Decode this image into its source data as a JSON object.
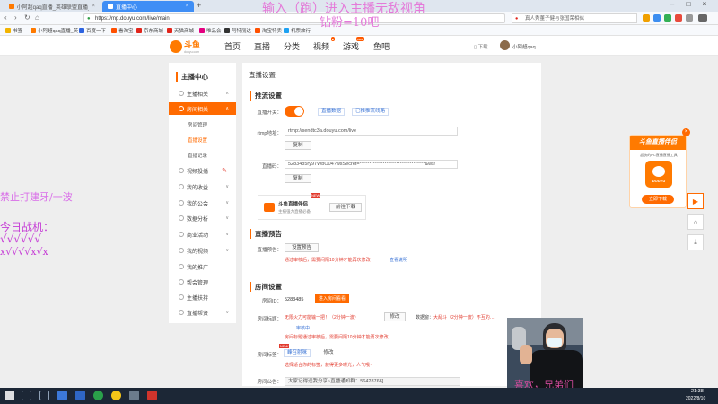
{
  "browser": {
    "tabs": [
      {
        "label": "小阿超qaq直播_英雄联盟直播_斗鱼直…",
        "active": false
      },
      {
        "label": "直播中心",
        "active": true
      }
    ],
    "url": "https://mp.douyu.com/live/main",
    "search_placeholder": "真人秀董子健与张国荣相似",
    "bookmarks": [
      "书签",
      "小阿超qaq直播_英",
      "百度一下",
      "看淘宝",
      "京东商城",
      "天猫商城",
      "唯品会",
      "阿特丽达",
      "淘宝特卖",
      "机票旅行"
    ]
  },
  "overlay": {
    "top_line1": "输入（跑）进入主播无敌视角",
    "top_line2": "钻粉=10吧",
    "left_line1": "禁止打建牙/一波",
    "left_line2": "今日战机：",
    "left_line3": "√√√√√√",
    "left_line4": "x√√√√x√x",
    "cam_caption": "喜欢，兄弟们"
  },
  "site": {
    "logo": "斗鱼",
    "logo_sub": "douyu.com",
    "nav": [
      {
        "label": "首页",
        "badge": ""
      },
      {
        "label": "直播",
        "badge": ""
      },
      {
        "label": "分类",
        "badge": ""
      },
      {
        "label": "视频",
        "badge": "●"
      },
      {
        "label": "游戏",
        "badge": "new"
      },
      {
        "label": "鱼吧",
        "badge": ""
      }
    ],
    "download": "下载",
    "user": "小阿超qaq"
  },
  "sidebar": {
    "title": "主播中心",
    "items": [
      {
        "label": "主播相关",
        "chev": "∧"
      },
      {
        "label": "房间相关",
        "chev": "∧",
        "active": true
      },
      {
        "label": "视频投播",
        "chev": ""
      },
      {
        "label": "我的收益",
        "chev": "∨"
      },
      {
        "label": "我的公会",
        "chev": "∨"
      },
      {
        "label": "数据分析",
        "chev": "∨"
      },
      {
        "label": "商业活动",
        "chev": "∨"
      },
      {
        "label": "我的视频",
        "chev": "∨"
      },
      {
        "label": "我的推广",
        "chev": ""
      },
      {
        "label": "帮会管理",
        "chev": ""
      },
      {
        "label": "主播扶持",
        "chev": ""
      },
      {
        "label": "直播帮贤",
        "chev": "∨"
      }
    ],
    "subitems": [
      "房间管理",
      "直播设置",
      "直播记录"
    ]
  },
  "main": {
    "page_title": "直播设置",
    "push_section": "推流设置",
    "switch_label": "直播开关：",
    "link_record": "直播数据",
    "link_rtmp": "已推推流线路",
    "rtmp_label": "rtmp地址：",
    "rtmp_value": "rtmp://sendtc3a.douyu.com/live",
    "copy": "复制",
    "code_label": "直播码：",
    "code_value": "5283485ry97WbO04?wsSecret=**********************************&ws!",
    "promo_title": "斗鱼直播伴侣",
    "promo_sub": "主播强力直播必备",
    "promo_new": "NEW",
    "promo_btn": "前往下载",
    "notice_section": "直播预告",
    "notice_label": "直播预告：",
    "notice_btn": "设置预告",
    "notice_hint": "通过审核后，需要间隔10分钟才能再次修改",
    "notice_link": "查看说明",
    "room_section": "房间设置",
    "room_id_label": "房间ID：",
    "room_id": "5283485",
    "room_btn": "进入房间看看",
    "room_title_label": "房间标题：",
    "room_title": "无限火力可能输一把！（2分钟一波）",
    "room_title_status": "审核中",
    "room_modify": "修改",
    "room_data_label": "数据窗：",
    "room_data": "大乱斗（2分钟一波）不互的…",
    "room_title_hint": "房间标题通过审核后，需要间隔10分钟才能再次修改",
    "room_tag_label": "房间标签：",
    "room_tag": "峰召射咪",
    "room_tag_new": "NEW",
    "room_tag_hint": "选择适合你的标签，获得更多曝光，人气哦~",
    "room_notice_label": "房间公告：",
    "room_notice": "大家记得送我分享~直播通知群：56428766]"
  },
  "promo_panel": {
    "title": "斗鱼直播伴侣",
    "sub": "超快的PC直播直播工具",
    "btn": "立即下载",
    "logo": "DOUYU"
  },
  "taskbar": {
    "time": "21:38",
    "date": "2022/8/10"
  }
}
